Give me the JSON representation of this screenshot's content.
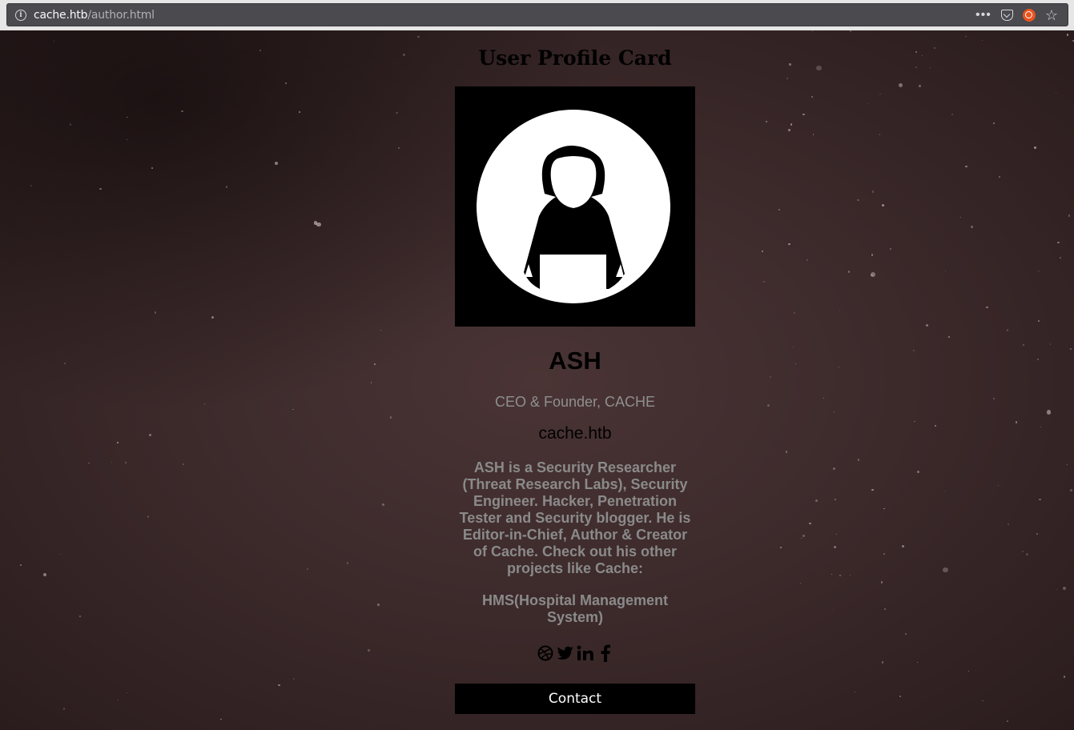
{
  "browser": {
    "url_host": "cache.htb",
    "url_path": "/author.html"
  },
  "card": {
    "title": "User Profile Card",
    "name": "ASH",
    "role": "CEO & Founder, CACHE",
    "site": "cache.htb",
    "bio": "ASH is a Security Researcher (Threat Research Labs), Security Engineer. Hacker, Penetration Tester and Security blogger. He is Editor-in-Chief, Author & Creator of Cache. Check out his other projects like Cache:",
    "project": "HMS(Hospital Management System)",
    "contact_label": "Contact",
    "socials": [
      "dribbble-icon",
      "twitter-icon",
      "linkedin-icon",
      "facebook-icon"
    ]
  },
  "colors": {
    "background": "#3a2829",
    "button": "#000000",
    "muted_text": "#8a8a8a"
  }
}
